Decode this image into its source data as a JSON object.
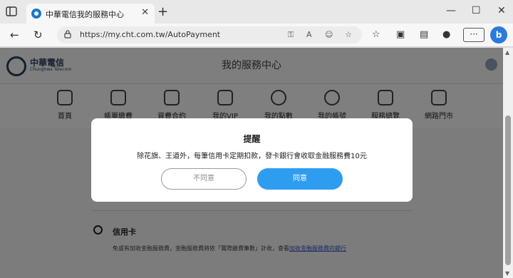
{
  "browser": {
    "tab_title": "中華電信我的服務中心",
    "url": "https://my.cht.com.tw/AutoPayment",
    "tab_close": "✕",
    "new_tab": "+",
    "window_controls": [
      "—",
      "☐",
      "✕"
    ],
    "more_label": "···",
    "bing_label": "b"
  },
  "page": {
    "logo_text": "中華電信",
    "logo_sub": "Chunghwa Telecom",
    "title": "我的服務中心",
    "nav_items": [
      {
        "label": "首頁",
        "icon": "home-icon"
      },
      {
        "label": "帳單繳費",
        "icon": "bill-icon"
      },
      {
        "label": "資費合約",
        "icon": "contract-icon"
      },
      {
        "label": "我的VIP",
        "icon": "vip-icon"
      },
      {
        "label": "我的點數",
        "icon": "points-icon"
      },
      {
        "label": "我的帳號",
        "icon": "account-icon"
      },
      {
        "label": "服務總覽",
        "icon": "services-icon"
      },
      {
        "label": "網路門市",
        "icon": "store-icon"
      }
    ],
    "option": {
      "label": "信用卡",
      "desc": "免或有加收金融服務費，金融服務費將依「實際繳費筆數」計收，查看",
      "link": "加收金融服務費的銀行"
    }
  },
  "modal": {
    "title": "提醒",
    "message": "除花旗、王道外，每筆信用卡定期扣款，發卡銀行會收取金融服務費10元",
    "disagree": "不同意",
    "agree": "同意"
  }
}
